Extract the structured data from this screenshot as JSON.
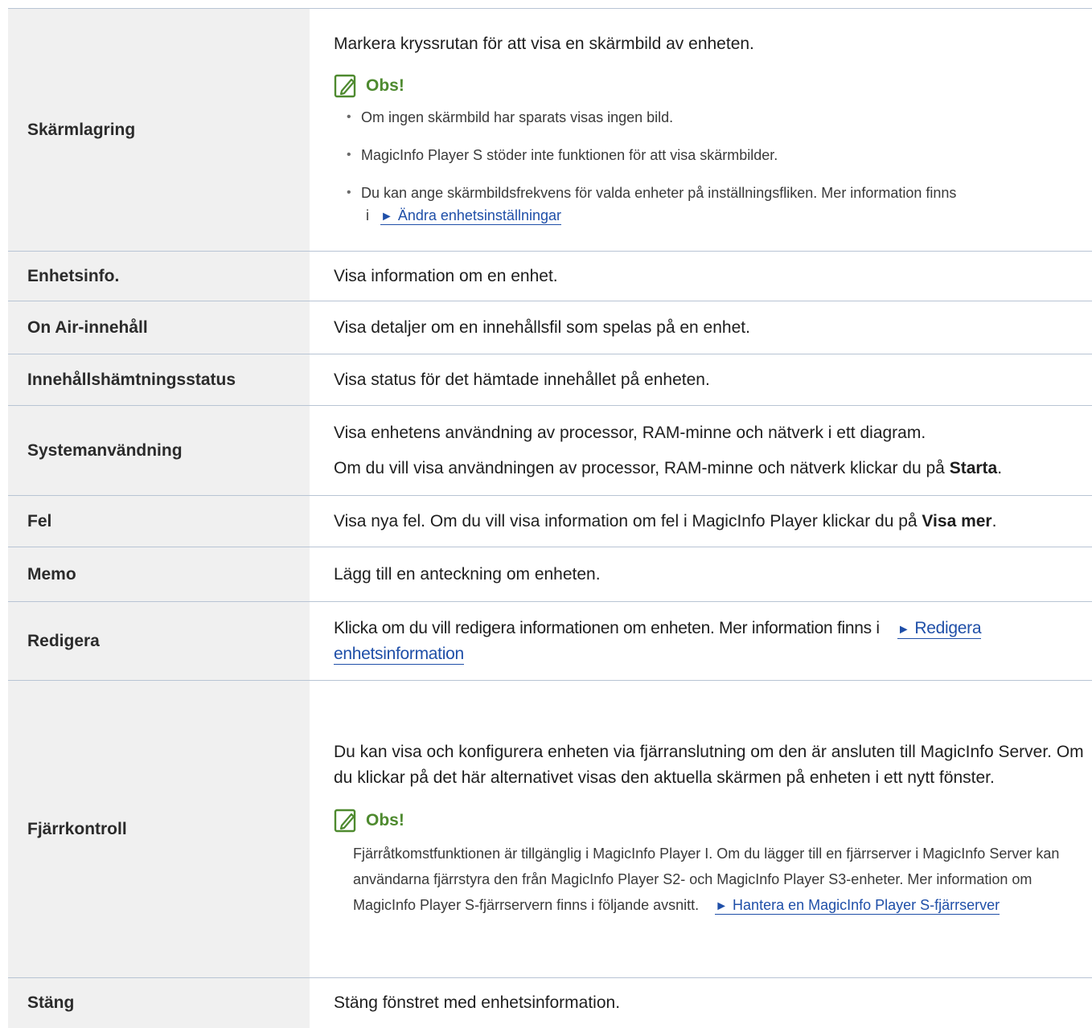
{
  "rows": [
    {
      "term": "Skärmlagring",
      "line1": "Markera kryssrutan för att visa en skärmbild av enheten.",
      "note_title": "Obs!",
      "bullets": [
        "Om ingen skärmbild har sparats visas ingen bild.",
        "MagicInfo Player S stöder inte funktionen för att visa skärmbilder.",
        "Du kan ange skärmbildsfrekvens för valda enheter på inställningsfliken. Mer information finns"
      ],
      "bullet3_prefix": "i",
      "link": "Ändra enhetsinställningar"
    },
    {
      "term": "Enhetsinfo.",
      "text": "Visa information om en enhet."
    },
    {
      "term": "On Air-innehåll",
      "text": "Visa detaljer om en innehållsfil som spelas på en enhet."
    },
    {
      "term": "Innehållshämtningsstatus",
      "text": "Visa status för det hämtade innehållet på enheten."
    },
    {
      "term": "Systemanvändning",
      "line1": "Visa enhetens användning av processor, RAM-minne och nätverk i ett diagram.",
      "line2_pre": "Om du vill visa användningen av processor, RAM-minne och nätverk klickar du på ",
      "line2_bold": "Starta",
      "line2_post": "."
    },
    {
      "term": "Fel",
      "pre": "Visa nya fel. Om du vill visa information om fel i MagicInfo Player klickar du på ",
      "bold": "Visa mer",
      "post": "."
    },
    {
      "term": "Memo",
      "text": "Lägg till en anteckning om enheten."
    },
    {
      "term": "Redigera",
      "pre": "Klicka om du vill redigera informationen om enheten. Mer information finns i",
      "link": "Redigera enhetsinformation"
    },
    {
      "term": "Fjärrkontroll",
      "text": "Du kan visa och konfigurera enheten via fjärranslutning om den är ansluten till MagicInfo Server. Om du klickar på det här alternativet visas den aktuella skärmen på enheten i ett nytt fönster.",
      "note_title": "Obs!",
      "note_text": "Fjärråtkomstfunktionen är tillgänglig i MagicInfo Player I. Om du lägger till en fjärrserver i MagicInfo Server kan användarna fjärrstyra den från MagicInfo Player S2- och MagicInfo Player S3-enheter. Mer information om MagicInfo Player S-fjärrservern finns i följande avsnitt.",
      "link": "Hantera en MagicInfo Player S-fjärrserver"
    },
    {
      "term": "Stäng",
      "text": "Stäng fönstret med enhetsinformation."
    }
  ],
  "arrow_glyph": "►",
  "colors": {
    "note_green": "#4e8a2f",
    "link_blue": "#1f4fa8",
    "term_bg": "#f0f0f0",
    "rule": "#b8c4d4"
  }
}
